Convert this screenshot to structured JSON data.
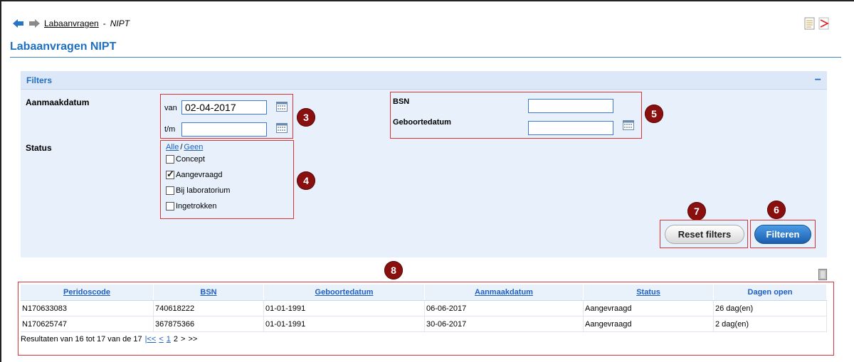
{
  "breadcrumb": {
    "link": "Labaanvragen",
    "sep": "-",
    "current": "NIPT"
  },
  "page_title": "Labaanvragen NIPT",
  "filters": {
    "title": "Filters",
    "collapse_symbol": "−",
    "aanmaakdatum_label": "Aanmaakdatum",
    "van_label": "van",
    "van_value": "02-04-2017",
    "tm_label": "t/m",
    "tm_value": "",
    "status_label": "Status",
    "alle_label": "Alle",
    "slash": "/",
    "geen_label": "Geen",
    "status_options": [
      {
        "label": "Concept",
        "checked": false
      },
      {
        "label": "Aangevraagd",
        "checked": true
      },
      {
        "label": "Bij laboratorium",
        "checked": false
      },
      {
        "label": "Ingetrokken",
        "checked": false
      }
    ],
    "bsn_label": "BSN",
    "bsn_value": "",
    "geboortedatum_label": "Geboortedatum",
    "geboortedatum_value": ""
  },
  "buttons": {
    "reset": "Reset filters",
    "filter": "Filteren"
  },
  "badges": {
    "b3": "3",
    "b4": "4",
    "b5": "5",
    "b6": "6",
    "b7": "7",
    "b8": "8"
  },
  "table": {
    "headers": [
      "Peridoscode",
      "BSN",
      "Geboortedatum",
      "Aanmaakdatum",
      "Status",
      "Dagen open"
    ],
    "rows": [
      [
        "N170633083",
        "740618222",
        "01-01-1991",
        "06-06-2017",
        "Aangevraagd",
        "26 dag(en)"
      ],
      [
        "N170625747",
        "367875366",
        "01-01-1991",
        "30-06-2017",
        "Aangevraagd",
        "2 dag(en)"
      ]
    ]
  },
  "pager": {
    "text": "Resultaten van 16 tot 17 van de 17",
    "first": "|<<",
    "prev": "<",
    "p1": "1",
    "p2": "2",
    "next": ">",
    "last": ">>"
  },
  "colors": {
    "accent": "#1f6fc0",
    "panel": "#e7f0fb",
    "badge": "#8a1010",
    "highlight": "#dd3333"
  },
  "icons": [
    "back-arrow-icon",
    "forward-arrow-icon",
    "document-icon",
    "pdf-icon",
    "calendar-icon",
    "export-icon"
  ]
}
